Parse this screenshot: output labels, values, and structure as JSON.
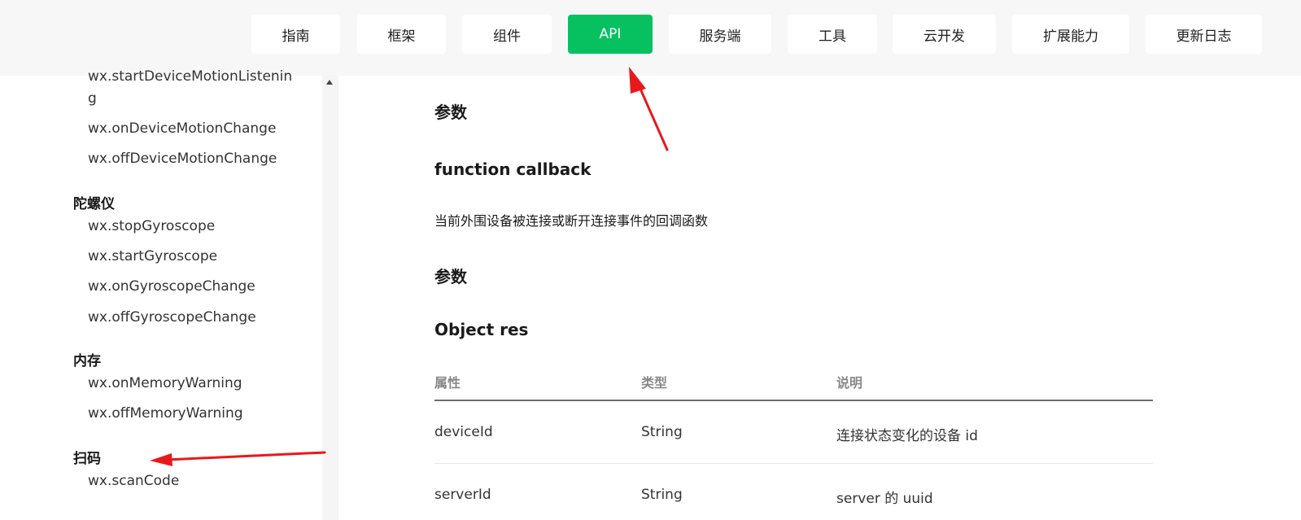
{
  "nav": {
    "items": [
      {
        "label": "指南"
      },
      {
        "label": "框架"
      },
      {
        "label": "组件"
      },
      {
        "label": "API",
        "active": true
      },
      {
        "label": "服务端"
      },
      {
        "label": "工具"
      },
      {
        "label": "云开发"
      },
      {
        "label": "扩展能力"
      },
      {
        "label": "更新日志"
      }
    ],
    "active_color": "#07c160"
  },
  "sidebar": {
    "truncated_item_line1": "wx.startDeviceMotionListenin",
    "truncated_item_line2": "g",
    "items_motion": [
      "wx.onDeviceMotionChange",
      "wx.offDeviceMotionChange"
    ],
    "group_gyro": "陀螺仪",
    "items_gyro": [
      "wx.stopGyroscope",
      "wx.startGyroscope",
      "wx.onGyroscopeChange",
      "wx.offGyroscopeChange"
    ],
    "group_memory": "内存",
    "items_memory": [
      "wx.onMemoryWarning",
      "wx.offMemoryWarning"
    ],
    "group_scan": "扫码",
    "items_scan": [
      "wx.scanCode"
    ]
  },
  "main": {
    "params_heading": "参数",
    "callback_heading": "function callback",
    "callback_desc": "当前外围设备被连接或断开连接事件的回调函数",
    "params_heading_2": "参数",
    "object_heading": "Object res",
    "table": {
      "headers": [
        "属性",
        "类型",
        "说明"
      ],
      "rows": [
        [
          "deviceId",
          "String",
          "连接状态变化的设备 id"
        ],
        [
          "serverId",
          "String",
          "server 的 uuid"
        ]
      ]
    }
  },
  "annotation_color": "#e8191b"
}
